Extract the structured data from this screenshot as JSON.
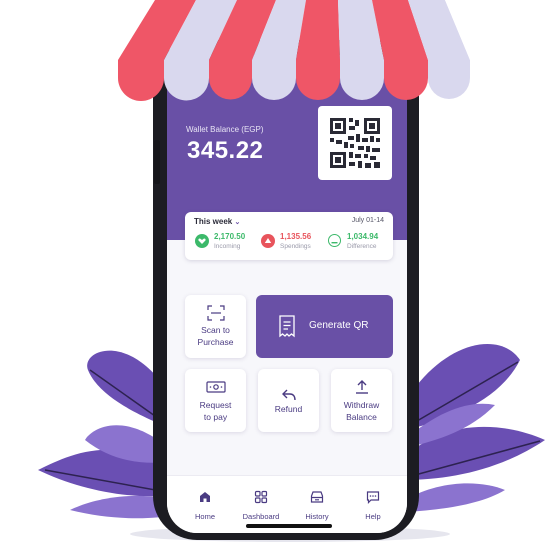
{
  "wallet": {
    "balance_label": "Wallet Balance (EGP)",
    "balance_value": "345.22"
  },
  "summary": {
    "period": "This week",
    "date_range": "July 01-14",
    "stats": [
      {
        "value": "2,170.50",
        "label": "Incoming",
        "color": "#3cb96a"
      },
      {
        "value": "1,135.56",
        "label": "Spendings",
        "color": "#e8545c"
      },
      {
        "value": "1,034.94",
        "label": "Difference",
        "color": "#3cb96a"
      }
    ]
  },
  "actions": {
    "scan_line1": "Scan to",
    "scan_line2": "Purchase",
    "generate": "Generate QR",
    "request_line1": "Request",
    "request_line2": "to pay",
    "refund": "Refund",
    "withdraw_line1": "Withdraw",
    "withdraw_line2": "Balance"
  },
  "nav": {
    "items": [
      {
        "label": "Home",
        "icon": "home-icon"
      },
      {
        "label": "Dashboard",
        "icon": "dashboard-icon"
      },
      {
        "label": "History",
        "icon": "history-icon"
      },
      {
        "label": "Help",
        "icon": "help-icon"
      }
    ]
  },
  "colors": {
    "brand": "#6950a6",
    "awning_red": "#ef5667",
    "awning_white": "#d9d8ee",
    "leaf": "#6a4fb3",
    "positive": "#3cb96a",
    "negative": "#e8545c"
  }
}
